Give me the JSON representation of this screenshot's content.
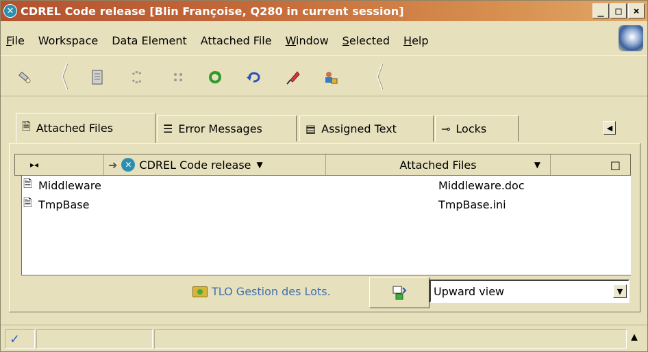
{
  "window": {
    "title": "CDREL Code release [Blin Françoise, Q280 in current session]",
    "icon": "x-circle-icon",
    "controls": {
      "minimize": "_",
      "maximize": "□",
      "close": "×"
    }
  },
  "menu": {
    "items": [
      {
        "label": "File",
        "underline": true
      },
      {
        "label": "Workspace",
        "underline": false
      },
      {
        "label": "Data Element",
        "underline": false
      },
      {
        "label": "Attached File",
        "underline": false
      },
      {
        "label": "Window",
        "underline": true
      },
      {
        "label": "Selected",
        "underline": true
      },
      {
        "label": "Help",
        "underline": true
      }
    ]
  },
  "toolbar": {
    "icons": [
      "flashlight-icon",
      "document-icon",
      "refresh-disabled-icon",
      "sync-disabled-icon",
      "refresh-green-icon",
      "undo-icon",
      "pin-icon",
      "user-lock-icon"
    ]
  },
  "tabs": [
    {
      "label": "Attached Files",
      "icon": "document-icon",
      "active": true
    },
    {
      "label": "Error Messages",
      "icon": "list-icon",
      "active": false
    },
    {
      "label": "Assigned Text",
      "icon": "document-grey-icon",
      "active": false
    },
    {
      "label": "Locks",
      "icon": "key-icon",
      "active": false
    }
  ],
  "table": {
    "header": {
      "expand": "▸◂",
      "element_label": "CDREL Code release",
      "files_label": "Attached Files",
      "corner": "□"
    },
    "rows": [
      {
        "name": "Middleware",
        "file": "Middleware.doc"
      },
      {
        "name": "TmpBase",
        "file": "TmpBase.ini"
      }
    ]
  },
  "footer": {
    "tlo_label": "TLO Gestion des Lots.",
    "view_select_value": "Upward view"
  },
  "status": {
    "check": "✓"
  },
  "colors": {
    "title_gradient_start": "#b3522f",
    "title_gradient_end": "#e2a868",
    "window_bg": "#e6e0bd",
    "link_blue": "#3f6fb0"
  }
}
